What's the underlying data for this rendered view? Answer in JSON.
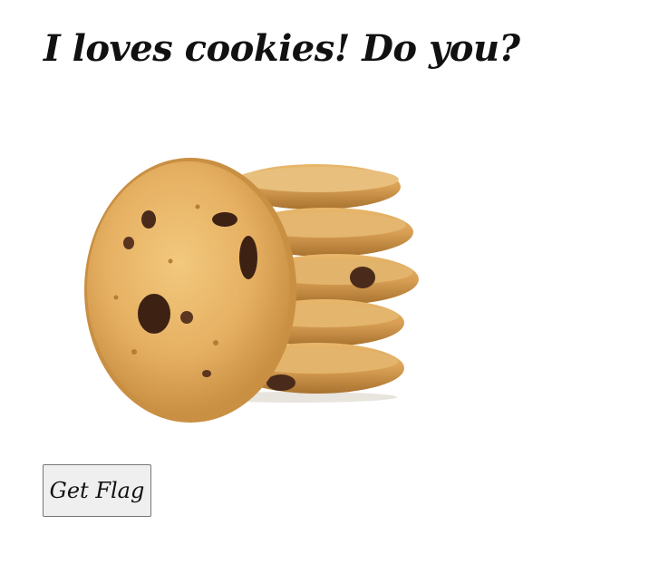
{
  "heading": {
    "text": "I loves cookies! Do you?"
  },
  "image": {
    "subject": "cookie-stack-image"
  },
  "button": {
    "label": "Get Flag"
  }
}
